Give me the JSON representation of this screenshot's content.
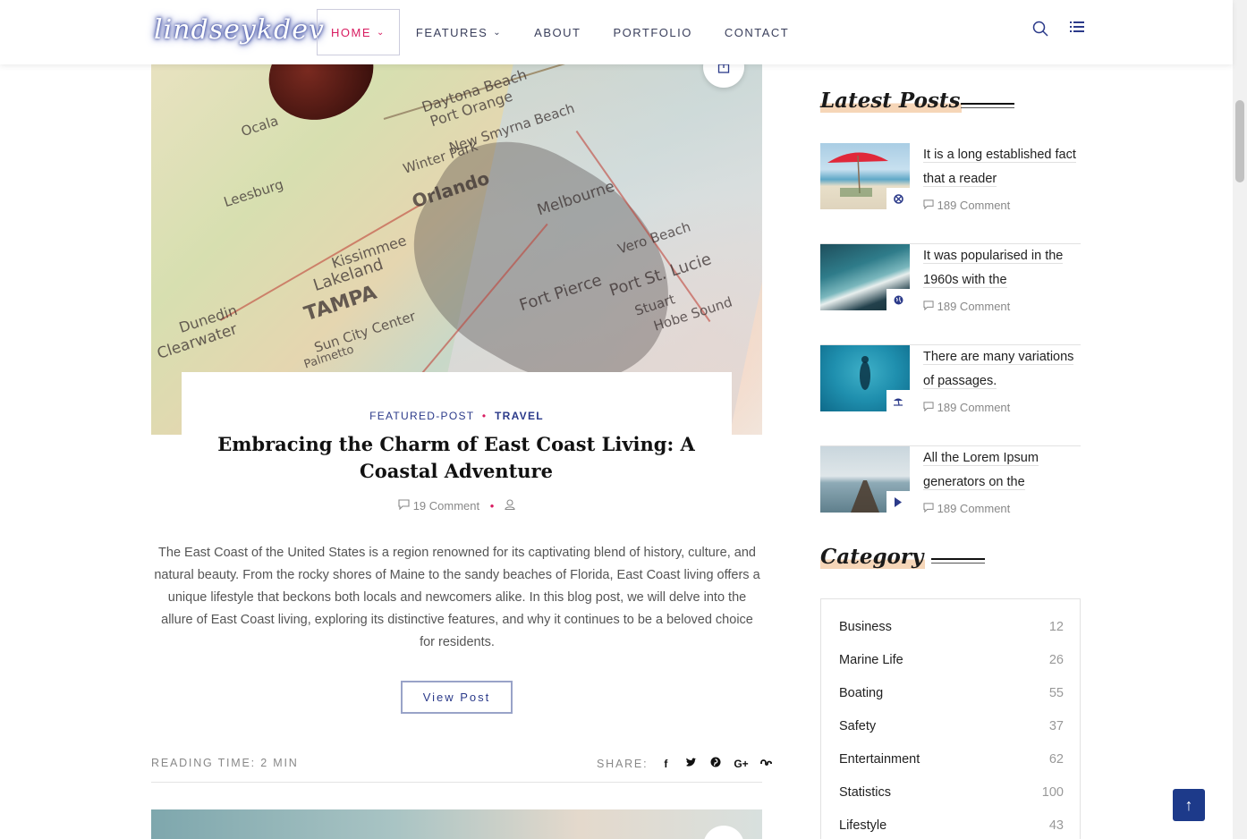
{
  "header": {
    "logo": "lindseykdev",
    "nav": [
      {
        "label": "Home",
        "has_dropdown": true,
        "active": true
      },
      {
        "label": "Features",
        "has_dropdown": true,
        "active": false
      },
      {
        "label": "About",
        "has_dropdown": false,
        "active": false
      },
      {
        "label": "Portfolio",
        "has_dropdown": false,
        "active": false
      },
      {
        "label": "Contact",
        "has_dropdown": false,
        "active": false
      }
    ],
    "icons": [
      "search-icon",
      "menu-list-icon"
    ]
  },
  "post": {
    "categories": [
      "FEATURED-POST",
      "TRAVEL"
    ],
    "separator": "•",
    "title": "Embracing the Charm of East Coast Living: A Coastal Adventure",
    "comments": "19 Comment",
    "excerpt": "The East Coast of the United States is a region renowned for its captivating blend of history, culture, and natural beauty. From the rocky shores of Maine to the sandy beaches of Florida, East Coast living offers a unique lifestyle that beckons both locals and newcomers alike. In this blog post, we will delve into the allure of East Coast living, exploring its distinctive features, and why it continues to be a beloved choice for residents.",
    "view_button": "View Post",
    "reading_time": "READING TIME: 2 MIN",
    "share_label": "SHARE:",
    "share_icons": [
      "facebook-icon",
      "twitter-icon",
      "pinterest-icon",
      "google-plus-icon",
      "stumbleupon-icon"
    ],
    "map_labels": [
      "Daytona Beach",
      "Port Orange",
      "New Smyrna Beach",
      "Orlando",
      "Melbourne",
      "Kissimmee",
      "Lakeland",
      "TAMPA",
      "Clearwater",
      "Dunedin",
      "Sun City Center",
      "Palmetto",
      "Fort Pierce",
      "Port St. Lucie",
      "Vero Beach",
      "Ocala",
      "Leesburg",
      "Winter Park",
      "Hobe Sound",
      "Stuart"
    ]
  },
  "sidebar": {
    "latest_title": "Latest Posts",
    "latest_posts": [
      {
        "title": "It is a long established fact that a reader",
        "comments": "189 Comment",
        "badge_icon": "gallery-icon",
        "thumb": "beach-umbrella"
      },
      {
        "title": "It was popularised in the 1960s with the",
        "comments": "189 Comment",
        "badge_icon": "globe-icon",
        "thumb": "coastline"
      },
      {
        "title": "There are many variations of passages.",
        "comments": "189 Comment",
        "badge_icon": "beach-icon",
        "thumb": "diver"
      },
      {
        "title": "All the Lorem Ipsum generators on the",
        "comments": "189 Comment",
        "badge_icon": "play-icon",
        "thumb": "pier"
      }
    ],
    "category_title": "Category",
    "categories": [
      {
        "name": "Business",
        "count": "12"
      },
      {
        "name": "Marine Life",
        "count": "26"
      },
      {
        "name": "Boating",
        "count": "55"
      },
      {
        "name": "Safety",
        "count": "37"
      },
      {
        "name": "Entertainment",
        "count": "62"
      },
      {
        "name": "Statistics",
        "count": "100"
      },
      {
        "name": "Lifestyle",
        "count": "43"
      }
    ]
  },
  "back_to_top": "↑",
  "colors": {
    "accent": "#d81b60",
    "brand": "#2b3a8a",
    "highlight": "#f6d6b8"
  }
}
